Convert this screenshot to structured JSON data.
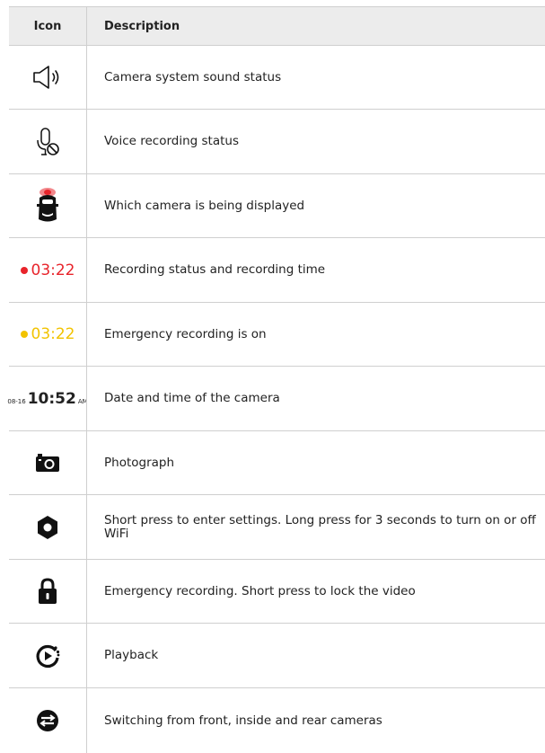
{
  "header": {
    "col_icon": "Icon",
    "col_description": "Description"
  },
  "colors": {
    "recording_red": "#e8242b",
    "emergency_yellow": "#f2c300",
    "border": "#cfcfcf",
    "header_bg": "#ececec"
  },
  "rows": [
    {
      "icon": "speaker-icon",
      "description": "Camera system sound status"
    },
    {
      "icon": "microphone-muted-icon",
      "description": "Voice recording status"
    },
    {
      "icon": "car-camera-view-icon",
      "description": "Which camera is being displayed"
    },
    {
      "icon": "recording-time-indicator",
      "time": "03:22",
      "description": "Recording status and recording time"
    },
    {
      "icon": "emergency-time-indicator",
      "time": "03:22",
      "description": "Emergency recording is on"
    },
    {
      "icon": "date-time-display",
      "date": "08-16",
      "time": "10:52",
      "ampm": "AM",
      "description": "Date and time of the camera"
    },
    {
      "icon": "camera-icon",
      "description": "Photograph"
    },
    {
      "icon": "gear-icon",
      "description": "Short press to enter settings. Long press for 3 seconds to turn on or off WiFi"
    },
    {
      "icon": "lock-icon",
      "description": "Emergency recording. Short press to lock the video"
    },
    {
      "icon": "playback-icon",
      "description": "Playback"
    },
    {
      "icon": "switch-camera-icon",
      "description": "Switching from front, inside and rear cameras"
    }
  ]
}
